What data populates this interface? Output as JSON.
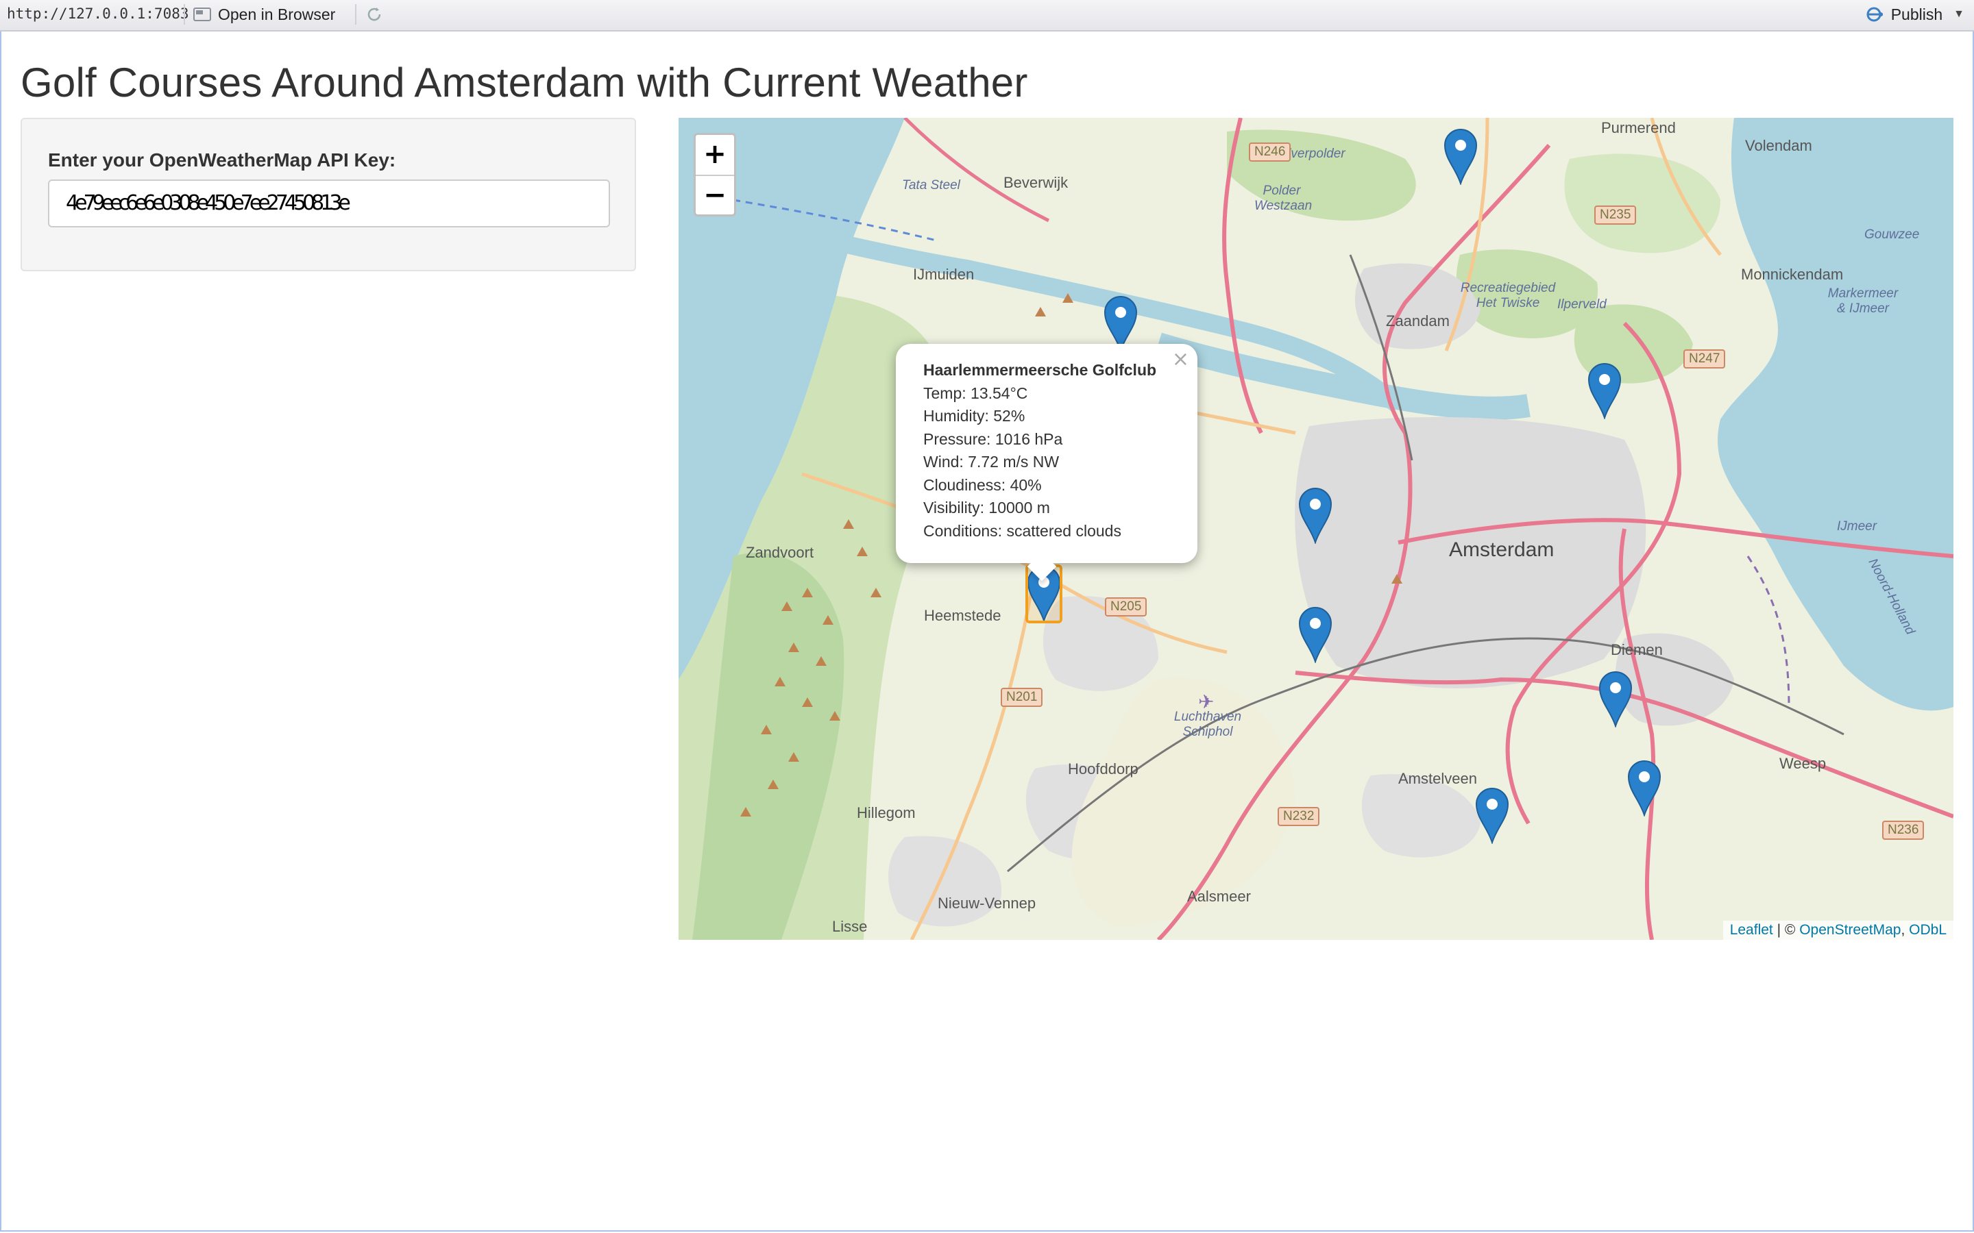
{
  "toolbar": {
    "url": "http://127.0.0.1:7083",
    "open_in_browser": "Open in Browser",
    "publish": "Publish",
    "icons": [
      "open-browser-icon",
      "refresh-icon",
      "publish-icon",
      "chevron-down-icon"
    ]
  },
  "page": {
    "title": "Golf Courses Around Amsterdam with Current Weather"
  },
  "sidebar": {
    "api_label": "Enter your OpenWeatherMap API Key:",
    "api_value": "4e79eec6e6e0308e450e7ee27450813e"
  },
  "map": {
    "zoom_in": "+",
    "zoom_out": "−",
    "attribution": {
      "leaflet": "Leaflet",
      "sep": " | © ",
      "osm": "OpenStreetMap",
      "comma": ", ",
      "odbl": "ODbL"
    },
    "places": {
      "purmerend": "Purmerend",
      "volendam": "Volendam",
      "beverwijk": "Beverwijk",
      "tata_steel": "Tata Steel",
      "polder_westzaan": "Polder Westzaan",
      "ijmuiden": "IJmuiden",
      "zaandam": "Zaandam",
      "monnickendam": "Monnickendam",
      "recreatiegebied": "Recreatiegebied Het Twiske",
      "ilperveld": "Ilperveld",
      "markermeer": "Markermeer & IJmeer",
      "gouwzee": "Gouwzee",
      "kalverpolder": "& Kalverpolder",
      "zandvoort": "Zandvoort",
      "amsterdam": "Amsterdam",
      "heemstede": "Heemstede",
      "ijmeer": "IJmeer",
      "diemen": "Diemen",
      "noord_holland": "Noord-Holland",
      "luchthaven": "Luchthaven Schiphol",
      "hoofddorp": "Hoofddorp",
      "hillegom": "Hillegom",
      "amstelveen": "Amstelveen",
      "weesp": "Weesp",
      "nieuw_vennep": "Nieuw-Vennep",
      "aalsmeer": "Aalsmeer",
      "lisse": "Lisse"
    },
    "roads": [
      "N246",
      "N235",
      "N247",
      "N205",
      "N201",
      "N232",
      "N236"
    ],
    "popup": {
      "name": "Haarlemmermeersche Golfclub",
      "temp": "Temp: 13.54°C",
      "humidity": "Humidity: 52%",
      "pressure": "Pressure: 1016 hPa",
      "wind": "Wind: 7.72 m/s NW",
      "cloudiness": "Cloudiness: 40%",
      "visibility": "Visibility: 10000 m",
      "conditions": "Conditions: scattered clouds",
      "close": "×"
    },
    "colors": {
      "water": "#aad3df",
      "land": "#eef0e0",
      "forest": "#add19e",
      "urban": "#dcdcdc",
      "motorway": "#e8788f",
      "primary": "#f6c88f",
      "marker": "#2a81cb"
    }
  }
}
